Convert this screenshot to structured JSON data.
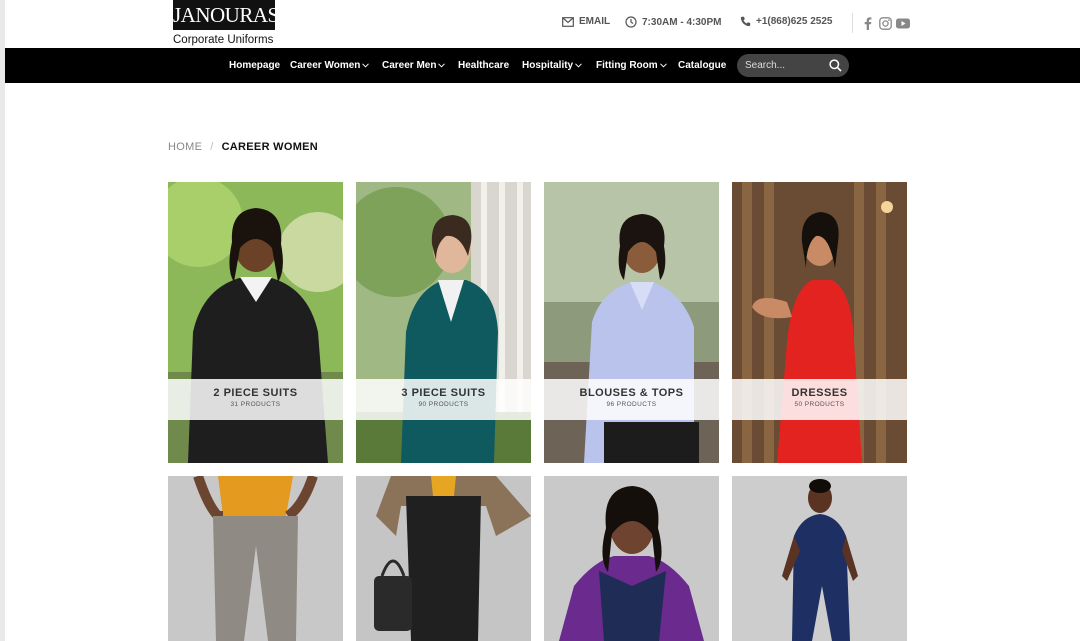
{
  "brand": {
    "logo_text": "JANOURAS",
    "tagline": "Corporate Uniforms"
  },
  "contact": {
    "email_label": "EMAIL",
    "hours": "7:30AM - 4:30PM",
    "phone": "+1(868)625 2525"
  },
  "social": [
    "facebook-icon",
    "instagram-icon",
    "youtube-icon"
  ],
  "nav": {
    "items": [
      {
        "label": "Homepage",
        "has_dropdown": false
      },
      {
        "label": "Career Women",
        "has_dropdown": true
      },
      {
        "label": "Career Men",
        "has_dropdown": true
      },
      {
        "label": "Healthcare",
        "has_dropdown": false
      },
      {
        "label": "Hospitality",
        "has_dropdown": true
      },
      {
        "label": "Fitting Room",
        "has_dropdown": true
      },
      {
        "label": "Catalogue",
        "has_dropdown": false
      }
    ],
    "search_placeholder": "Search..."
  },
  "breadcrumb": {
    "home": "HOME",
    "separator": "/",
    "current": "CAREER WOMEN"
  },
  "categories": [
    {
      "title": "2 PIECE SUITS",
      "count": "31 PRODUCTS"
    },
    {
      "title": "3 PIECE SUITS",
      "count": "90 PRODUCTS"
    },
    {
      "title": "BLOUSES & TOPS",
      "count": "96 PRODUCTS"
    },
    {
      "title": "DRESSES",
      "count": "50 PRODUCTS"
    }
  ],
  "colors": {
    "nav_bg": "#000000",
    "accent_dark": "#111111",
    "search_bg": "#444444"
  }
}
